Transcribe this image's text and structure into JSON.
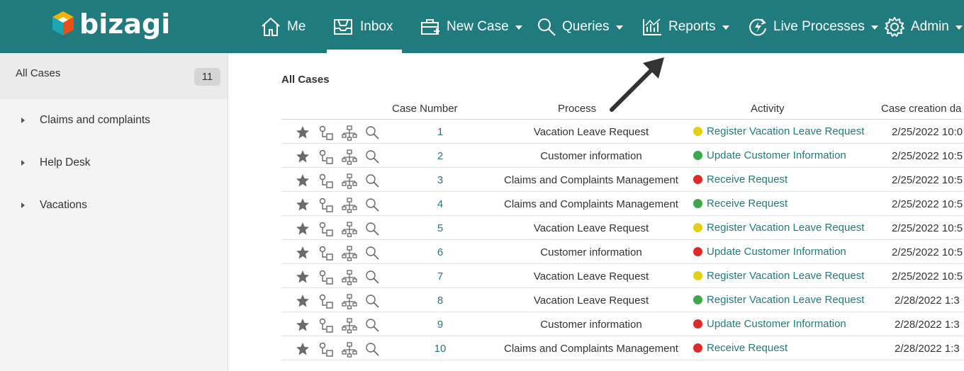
{
  "app": {
    "logo_text": "bizagi"
  },
  "nav": {
    "me": "Me",
    "inbox": "Inbox",
    "new_case": "New Case",
    "queries": "Queries",
    "reports": "Reports",
    "live_processes": "Live Processes",
    "admin": "Admin"
  },
  "sidebar": {
    "all_cases_label": "All Cases",
    "all_cases_count": "11",
    "items": [
      {
        "label": "Claims and complaints"
      },
      {
        "label": "Help Desk"
      },
      {
        "label": "Vacations"
      }
    ]
  },
  "main": {
    "title": "All Cases",
    "columns": [
      "Case Number",
      "Process",
      "Activity",
      "Case creation da"
    ],
    "rows": [
      {
        "case": "1",
        "process": "Vacation Leave Request",
        "activity": "Register Vacation Leave Request",
        "status": "yellow",
        "date": "2/25/2022 10:0"
      },
      {
        "case": "2",
        "process": "Customer information",
        "activity": "Update Customer Information",
        "status": "green",
        "date": "2/25/2022 10:5"
      },
      {
        "case": "3",
        "process": "Claims and Complaints Management",
        "activity": "Receive Request",
        "status": "red",
        "date": "2/25/2022 10:5"
      },
      {
        "case": "4",
        "process": "Claims and Complaints Management",
        "activity": "Receive Request",
        "status": "green",
        "date": "2/25/2022 10:5"
      },
      {
        "case": "5",
        "process": "Vacation Leave Request",
        "activity": "Register Vacation Leave Request",
        "status": "yellow",
        "date": "2/25/2022 10:5"
      },
      {
        "case": "6",
        "process": "Customer information",
        "activity": "Update Customer Information",
        "status": "red",
        "date": "2/25/2022 10:5"
      },
      {
        "case": "7",
        "process": "Vacation Leave Request",
        "activity": "Register Vacation Leave Request",
        "status": "yellow",
        "date": "2/25/2022 10:5"
      },
      {
        "case": "8",
        "process": "Vacation Leave Request",
        "activity": "Register Vacation Leave Request",
        "status": "green",
        "date": "2/28/2022 1:3"
      },
      {
        "case": "9",
        "process": "Customer information",
        "activity": "Update Customer Information",
        "status": "red",
        "date": "2/28/2022 1:3"
      },
      {
        "case": "10",
        "process": "Claims and Complaints Management",
        "activity": "Receive Request",
        "status": "red",
        "date": "2/28/2022 1:3"
      }
    ]
  },
  "colors": {
    "brand": "#1f7b7d",
    "status_yellow": "#e3cf14",
    "status_green": "#3ea84a",
    "status_red": "#e02a2a"
  },
  "icons": [
    "home-icon",
    "inbox-icon",
    "new-case-icon",
    "search-icon",
    "reports-icon",
    "live-processes-icon",
    "gear-icon",
    "star-icon",
    "workflow-icon",
    "hierarchy-icon",
    "magnifier-icon"
  ]
}
